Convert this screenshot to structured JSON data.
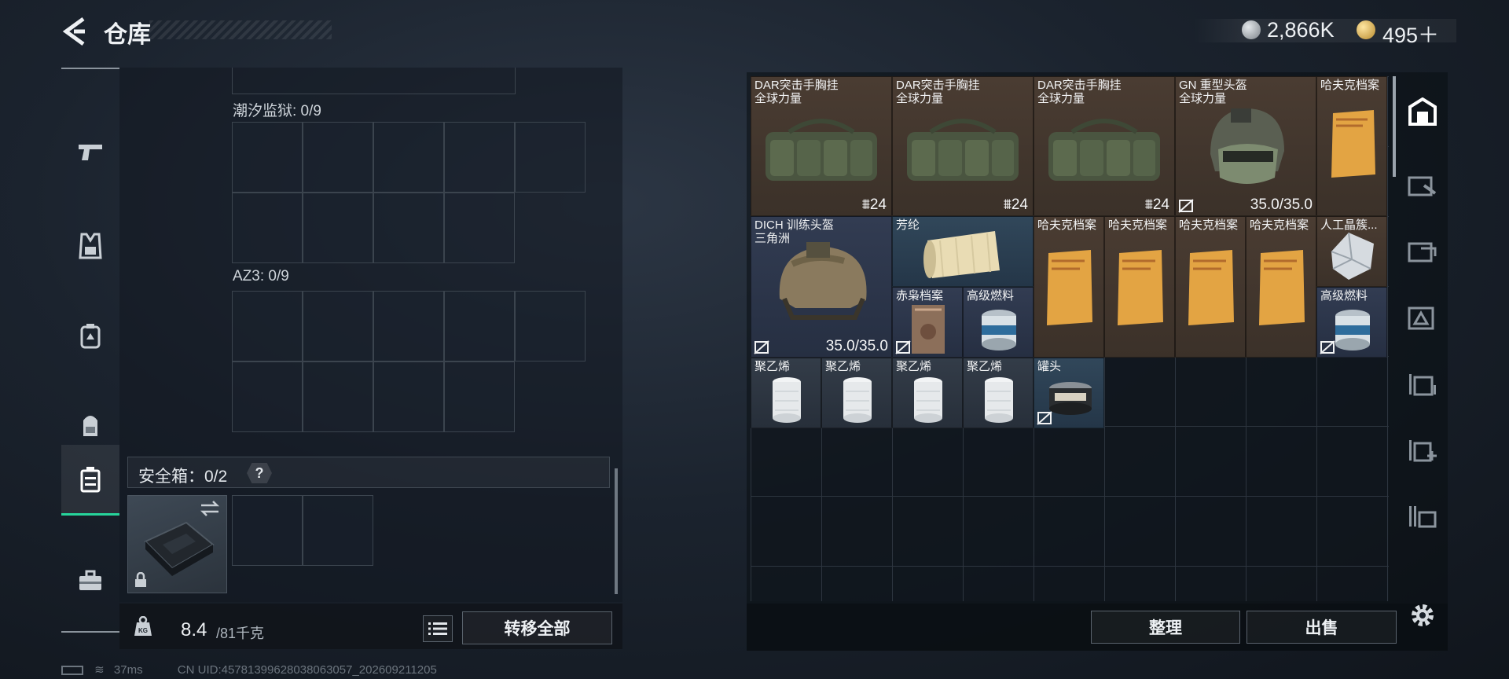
{
  "header": {
    "title": "仓库"
  },
  "currency": {
    "silver": "2,866K",
    "gold": "495＋"
  },
  "containers": [
    {
      "label": "潮汐监狱: 0/9"
    },
    {
      "label": "AZ3: 0/9"
    }
  ],
  "safe_box": {
    "label": "安全箱：0/2",
    "help": "?"
  },
  "weight": {
    "current": "8.4",
    "max": "/81千克",
    "icon_text": "KG"
  },
  "buttons": {
    "transfer_all": "转移全部",
    "sort": "整理",
    "sell": "出售"
  },
  "status": {
    "ping": "37ms",
    "uid": "CN UID:45781399628038063057_202609211205"
  },
  "left_tabs": [
    "pistol-icon",
    "vest-icon",
    "armor-icon",
    "backpack-icon",
    "safe-box-icon",
    "toolbox-icon"
  ],
  "right_tabs": [
    "stash-home-icon",
    "stash-page-1-icon",
    "stash-page-2-icon",
    "stash-page-3-icon",
    "stash-page-4-icon",
    "stash-add-icon",
    "stash-page-5-icon"
  ],
  "items": {
    "vest1": {
      "name": "DAR突击手胸挂",
      "sub": "全球力量",
      "count": "24"
    },
    "vest2": {
      "name": "DAR突击手胸挂",
      "sub": "全球力量",
      "count": "24"
    },
    "vest3": {
      "name": "DAR突击手胸挂",
      "sub": "全球力量",
      "count": "24"
    },
    "gn_helmet": {
      "name": "GN 重型头盔",
      "sub": "全球力量",
      "durability": "35.0/35.0"
    },
    "file_top": {
      "name": "哈夫克档案"
    },
    "dich_helmet": {
      "name": "DICH 训练头盔",
      "sub": "三角洲",
      "durability": "35.0/35.0"
    },
    "aramid": {
      "name": "芳纶"
    },
    "red_owl": {
      "name": "赤枭档案"
    },
    "fuel1": {
      "name": "高级燃料"
    },
    "file1": {
      "name": "哈夫克档案"
    },
    "file2": {
      "name": "哈夫克档案"
    },
    "file3": {
      "name": "哈夫克档案"
    },
    "file4": {
      "name": "哈夫克档案"
    },
    "crystal": {
      "name": "人工晶簇..."
    },
    "fuel2": {
      "name": "高级燃料"
    },
    "pe1": {
      "name": "聚乙烯"
    },
    "pe2": {
      "name": "聚乙烯"
    },
    "pe3": {
      "name": "聚乙烯"
    },
    "pe4": {
      "name": "聚乙烯"
    },
    "can": {
      "name": "罐头"
    }
  },
  "colors": {
    "accent": "#27d49b",
    "brown_rarity": "#4a3c32",
    "blue_rarity": "#323c52"
  }
}
